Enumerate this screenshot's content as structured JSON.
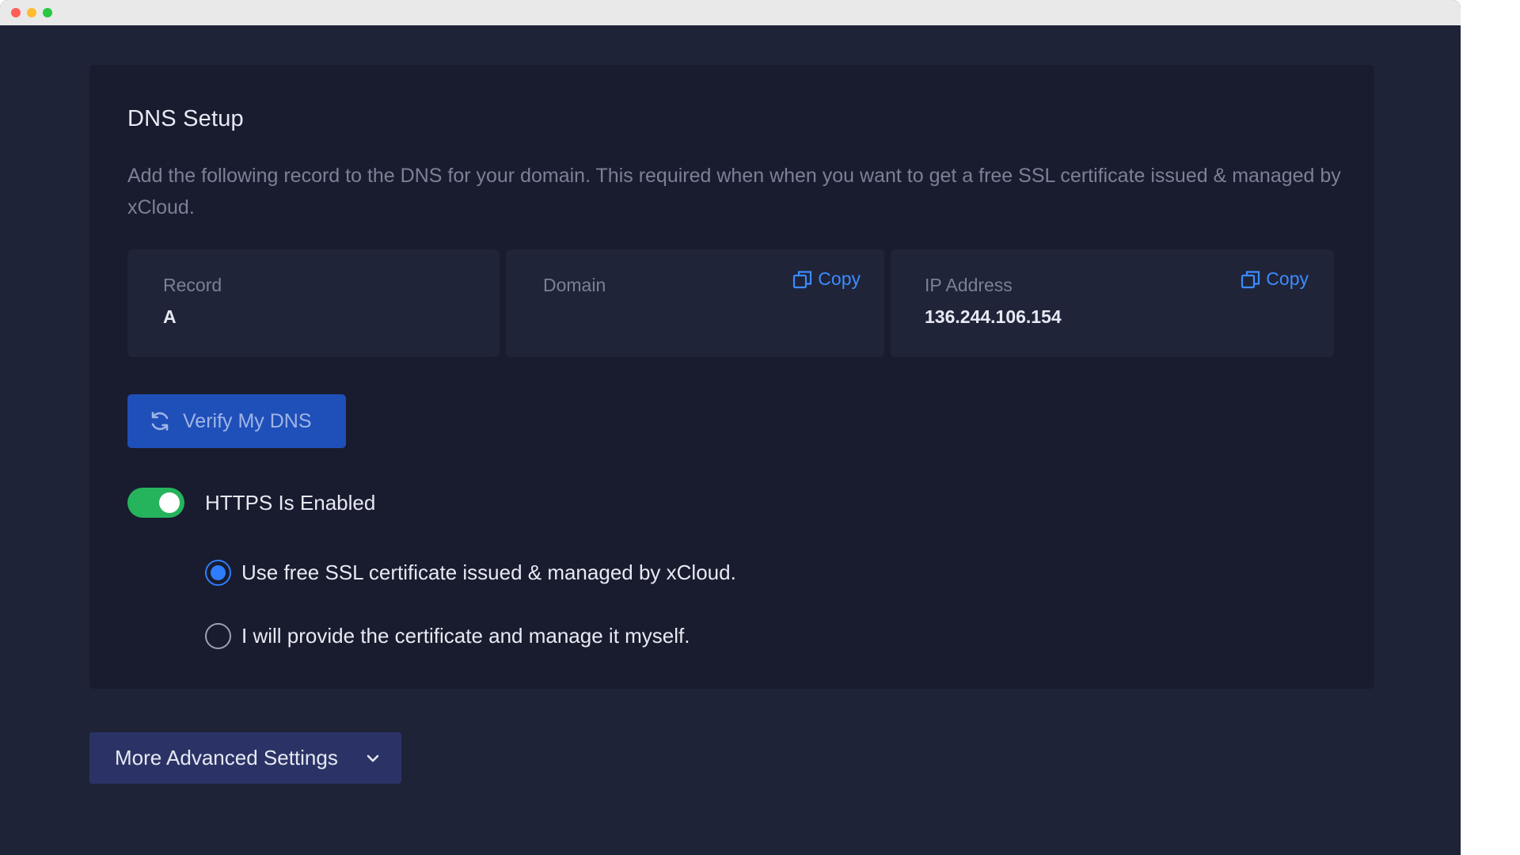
{
  "window": {
    "controls": [
      {
        "name": "close",
        "color": "#ff5f57"
      },
      {
        "name": "minimize",
        "color": "#febc2e"
      },
      {
        "name": "maximize",
        "color": "#28c840"
      }
    ]
  },
  "dns": {
    "title": "DNS Setup",
    "description": "Add the following record to the DNS for your domain. This required when when you want to get a free SSL certificate issued & managed by xCloud.",
    "records": {
      "record": {
        "label": "Record",
        "value": "A"
      },
      "domain": {
        "label": "Domain",
        "value": "",
        "copy_label": "Copy"
      },
      "ip": {
        "label": "IP Address",
        "value": "136.244.106.154",
        "copy_label": "Copy"
      }
    },
    "verify_button": {
      "label": "Verify My DNS",
      "icon": "refresh-icon"
    },
    "https": {
      "label": "HTTPS Is Enabled",
      "enabled": true,
      "accent": "#25b35b"
    },
    "ssl_options": {
      "selected": "free",
      "options": [
        {
          "id": "free",
          "label": "Use free SSL certificate issued & managed by xCloud."
        },
        {
          "id": "own",
          "label": "I will provide the certificate and manage it myself."
        }
      ]
    }
  },
  "advanced": {
    "label": "More Advanced Settings",
    "icon": "chevron-down-icon"
  },
  "colors": {
    "background": "#1e2338",
    "card": "#181c2e",
    "link": "#3d8bff",
    "primary_button": "#1f4fb8",
    "radio_selected": "#2f7dff"
  }
}
